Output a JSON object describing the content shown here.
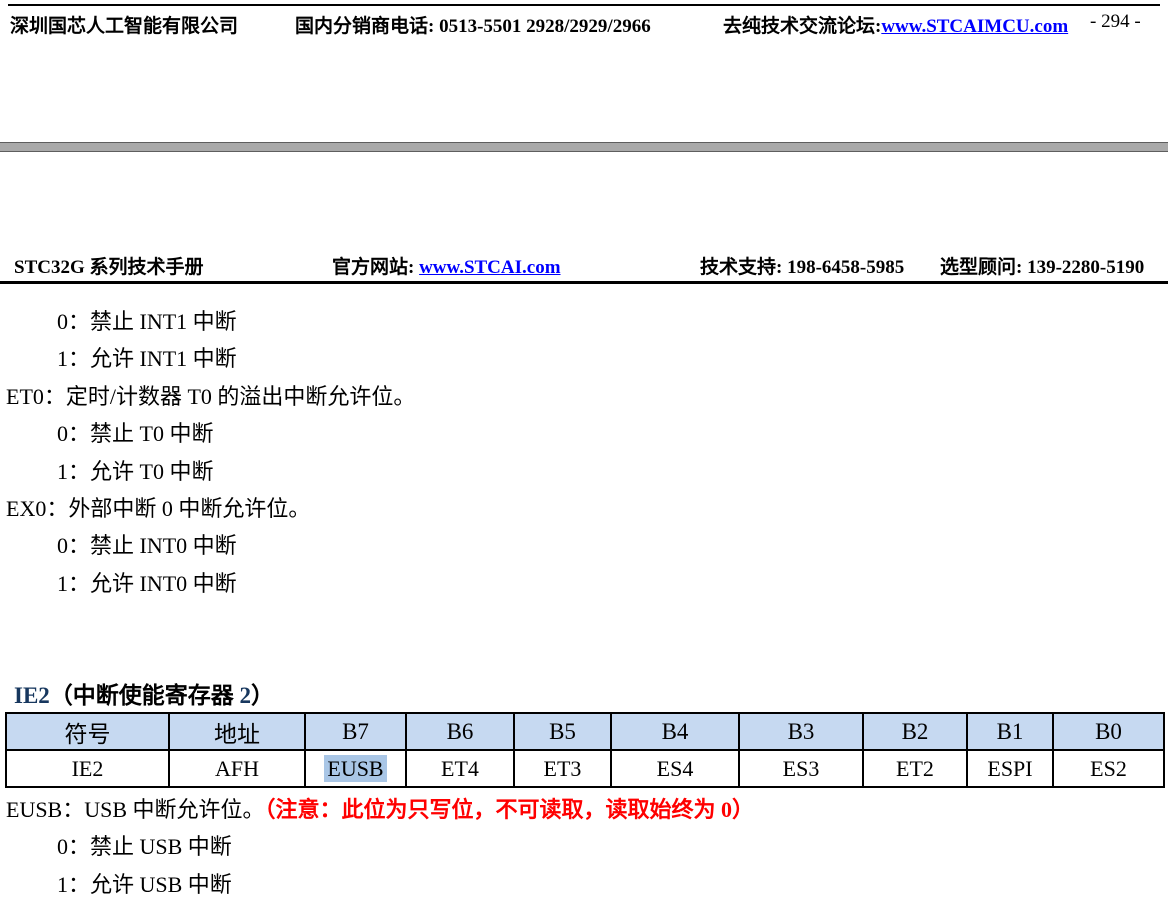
{
  "prev_page_footer": {
    "company": "深圳国芯人工智能有限公司",
    "distributor": "国内分销商电话: 0513-5501 2928/2929/2966",
    "forum_label": "去纯技术交流论坛:",
    "forum_link": "www.STCAIMCU.com",
    "page_number": "- 294 -"
  },
  "page_header": {
    "manual_title": "STC32G 系列技术手册",
    "site_label": "官方网站: ",
    "site_link": "www.STCAI.com",
    "tech_support": "技术支持: 198-6458-5985",
    "selection_advisor": "选型顾问: 139-2280-5190"
  },
  "body_lines": [
    {
      "indent": true,
      "text": "0：禁止 INT1 中断"
    },
    {
      "indent": true,
      "text": "1：允许 INT1 中断"
    },
    {
      "indent": false,
      "text": "ET0：定时/计数器 T0 的溢出中断允许位。"
    },
    {
      "indent": true,
      "text": "0：禁止 T0 中断"
    },
    {
      "indent": true,
      "text": "1：允许 T0 中断"
    },
    {
      "indent": false,
      "text": "EX0：外部中断 0 中断允许位。"
    },
    {
      "indent": true,
      "text": "0：禁止 INT0 中断"
    },
    {
      "indent": true,
      "text": "1：允许 INT0 中断"
    }
  ],
  "ie2_section": {
    "reg_name": "IE2",
    "title_open": "（中断使能寄存器 ",
    "title_num": "2",
    "title_close": "）"
  },
  "register_table": {
    "headers": [
      "符号",
      "地址",
      "B7",
      "B6",
      "B5",
      "B4",
      "B3",
      "B2",
      "B1",
      "B0"
    ],
    "row": [
      "IE2",
      "AFH",
      "EUSB",
      "ET4",
      "ET3",
      "ES4",
      "ES3",
      "ET2",
      "ESPI",
      "ES2"
    ],
    "highlighted_cell": "EUSB"
  },
  "eusb_desc": {
    "normal": "EUSB：USB 中断允许位。",
    "warning": "（注意：此位为只写位，不可读取，读取始终为 0）"
  },
  "eusb_options": [
    "0：禁止 USB 中断",
    "1：允许 USB 中断"
  ],
  "colors": {
    "link_blue": "#0000FF",
    "heading_accent": "#17375E",
    "warning_red": "#FF0000",
    "table_header_bg": "#C6D9F1",
    "selection_highlight": "#A9C6E6",
    "separator_gray": "#A9A9A9"
  }
}
